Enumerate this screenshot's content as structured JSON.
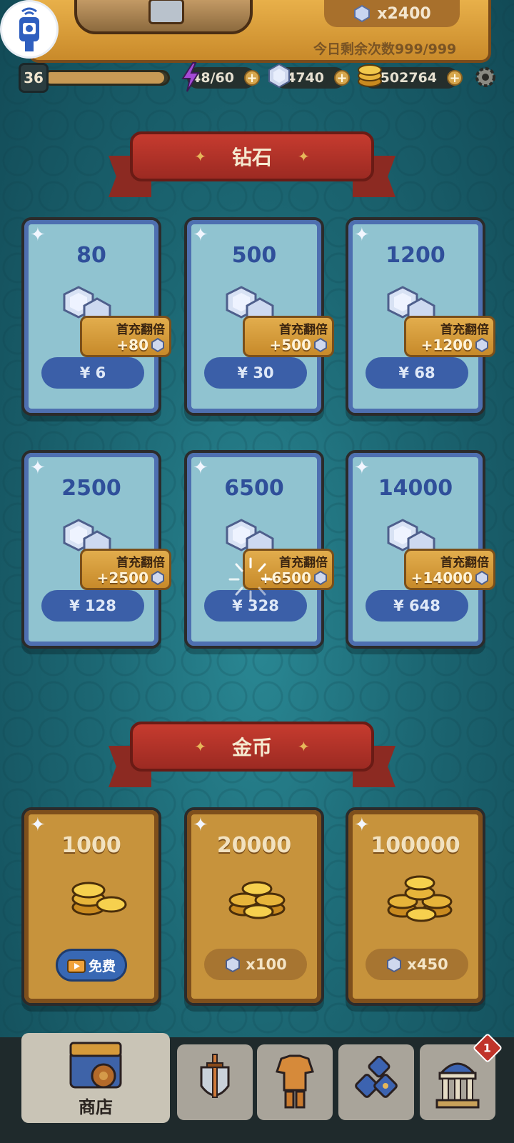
{
  "top_banner": {
    "chest_cost": "x2400",
    "daily_remaining": "今日剩余次数999/999"
  },
  "resources": {
    "level": "36",
    "xp_fraction": 0.97,
    "energy": "48/60",
    "gems": "4740",
    "gold": "502764"
  },
  "gem_section": {
    "title": "钻石",
    "packs": [
      {
        "amount": "80",
        "bonus_title": "首充翻倍",
        "bonus": "+80",
        "price": "¥ 6"
      },
      {
        "amount": "500",
        "bonus_title": "首充翻倍",
        "bonus": "+500",
        "price": "¥ 30"
      },
      {
        "amount": "1200",
        "bonus_title": "首充翻倍",
        "bonus": "+1200",
        "price": "¥ 68"
      },
      {
        "amount": "2500",
        "bonus_title": "首充翻倍",
        "bonus": "+2500",
        "price": "¥ 128"
      },
      {
        "amount": "6500",
        "bonus_title": "首充翻倍",
        "bonus": "+6500",
        "price": "¥ 328"
      },
      {
        "amount": "14000",
        "bonus_title": "首充翻倍",
        "bonus": "+14000",
        "price": "¥ 648"
      }
    ]
  },
  "gold_section": {
    "title": "金币",
    "packs": [
      {
        "amount": "1000",
        "price": "免费"
      },
      {
        "amount": "20000",
        "price": "x100"
      },
      {
        "amount": "100000",
        "price": "x450"
      }
    ]
  },
  "nav": {
    "shop_label": "商店",
    "museum_badge": "1"
  },
  "colors": {
    "gem_card": "#90c3d0",
    "gold_card": "#c7933c",
    "ribbon": "#c63b2f",
    "price_button": "#3b5fa8"
  }
}
